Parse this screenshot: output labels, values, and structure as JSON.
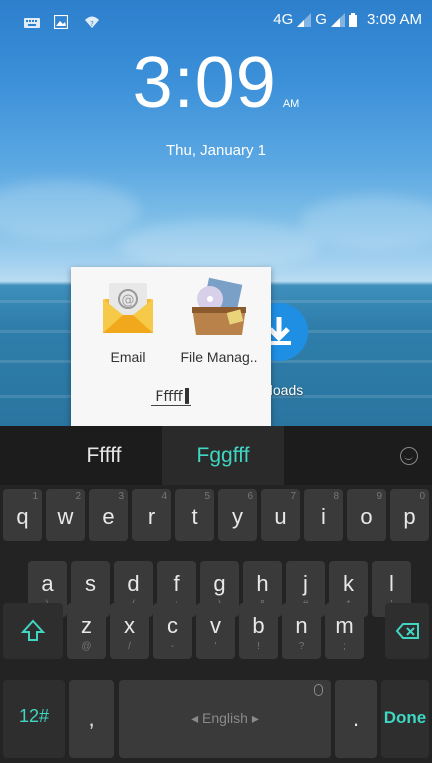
{
  "status_bar": {
    "network_4g": "4G",
    "network_g": "G",
    "time": "3:09 AM"
  },
  "lock_clock": {
    "time": "3:09",
    "ampm": "AM",
    "date": "Thu, January 1"
  },
  "background_app": {
    "label": "nloads"
  },
  "folder": {
    "apps": [
      {
        "label": "Email",
        "icon": "email-icon"
      },
      {
        "label": "File Manag..",
        "icon": "file-manager-icon"
      }
    ],
    "name": "Fffff"
  },
  "keyboard": {
    "suggestions": [
      "Fffff",
      "Fggfff"
    ],
    "row1": [
      {
        "k": "q",
        "n": "1"
      },
      {
        "k": "w",
        "n": "2"
      },
      {
        "k": "e",
        "n": "3"
      },
      {
        "k": "r",
        "n": "4"
      },
      {
        "k": "t",
        "n": "5"
      },
      {
        "k": "y",
        "n": "6"
      },
      {
        "k": "u",
        "n": "7"
      },
      {
        "k": "i",
        "n": "8"
      },
      {
        "k": "o",
        "n": "9"
      },
      {
        "k": "p",
        "n": "0"
      }
    ],
    "row2": [
      {
        "k": "a",
        "s": "\\"
      },
      {
        "k": "s",
        "s": ""
      },
      {
        "k": "d",
        "s": "("
      },
      {
        "k": "f",
        "s": ":"
      },
      {
        "k": "g",
        "s": ")"
      },
      {
        "k": "h",
        "s": "&"
      },
      {
        "k": "j",
        "s": "#"
      },
      {
        "k": "k",
        "s": "*"
      },
      {
        "k": "l",
        "s": "'"
      }
    ],
    "row3": [
      {
        "k": "z",
        "s": "@"
      },
      {
        "k": "x",
        "s": "/"
      },
      {
        "k": "c",
        "s": "-"
      },
      {
        "k": "v",
        "s": "'"
      },
      {
        "k": "b",
        "s": "!"
      },
      {
        "k": "n",
        "s": "?"
      },
      {
        "k": "m",
        "s": ";"
      }
    ],
    "symbols_key": "12#",
    "comma_key": ",",
    "space_label": "◂ English ▸",
    "period_key": ".",
    "done_key": "Done"
  },
  "colors": {
    "accent": "#3fd6c2",
    "key_bg": "#3a3a3a",
    "keyboard_bg": "#232323"
  }
}
